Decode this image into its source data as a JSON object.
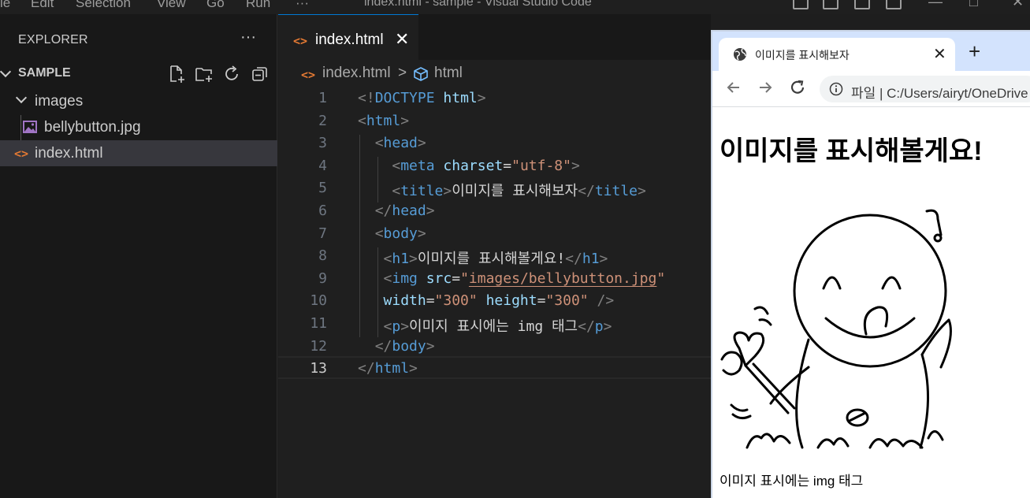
{
  "window": {
    "title": "index.html - sample - Visual Studio Code",
    "menu": [
      "le",
      "Edit",
      "Selection",
      "View",
      "Go",
      "Run",
      "···"
    ]
  },
  "sidebar": {
    "title": "EXPLORER",
    "more": "···",
    "folder": "SAMPLE",
    "items": [
      {
        "label": "images",
        "type": "folder"
      },
      {
        "label": "bellybutton.jpg",
        "type": "image"
      },
      {
        "label": "index.html",
        "type": "html",
        "selected": true
      }
    ]
  },
  "editor": {
    "tab": {
      "icon": "<>",
      "label": "index.html",
      "close": "✕"
    },
    "breadcrumb": {
      "file": "index.html",
      "separator": ">",
      "symbol": "html"
    },
    "lines": [
      {
        "n": "1"
      },
      {
        "n": "2"
      },
      {
        "n": "3"
      },
      {
        "n": "4"
      },
      {
        "n": "5"
      },
      {
        "n": "6"
      },
      {
        "n": "7"
      },
      {
        "n": "8"
      },
      {
        "n": "9"
      },
      {
        "n": "10"
      },
      {
        "n": "11"
      },
      {
        "n": "12"
      },
      {
        "n": "13"
      }
    ],
    "code": {
      "doctype": "DOCTYPE",
      "html": "html",
      "head": "head",
      "meta": "meta",
      "charset_attr": "charset",
      "charset_val": "\"utf-8\"",
      "title_tag": "title",
      "title_text": "이미지를 표시해보자",
      "body": "body",
      "h1_tag": "h1",
      "h1_text": "이미지를 표시해볼게요!",
      "img_tag": "img",
      "src_attr": "src",
      "src_val": "images/bellybutton.jpg",
      "width_attr": "width",
      "width_val": "\"300\"",
      "height_attr": "height",
      "height_val": "\"300\"",
      "p_tag": "p",
      "p_text": "이미지 표시에는 img 태그"
    },
    "current_line": "13"
  },
  "browser": {
    "tab_title": "이미지를 표시해보자",
    "tab_close": "✕",
    "new_tab": "+",
    "address": "파일  |  C:/Users/airyt/OneDrive",
    "page": {
      "h1": "이미지를 표시해볼게요!",
      "p": "이미지 표시에는 img 태그"
    }
  }
}
